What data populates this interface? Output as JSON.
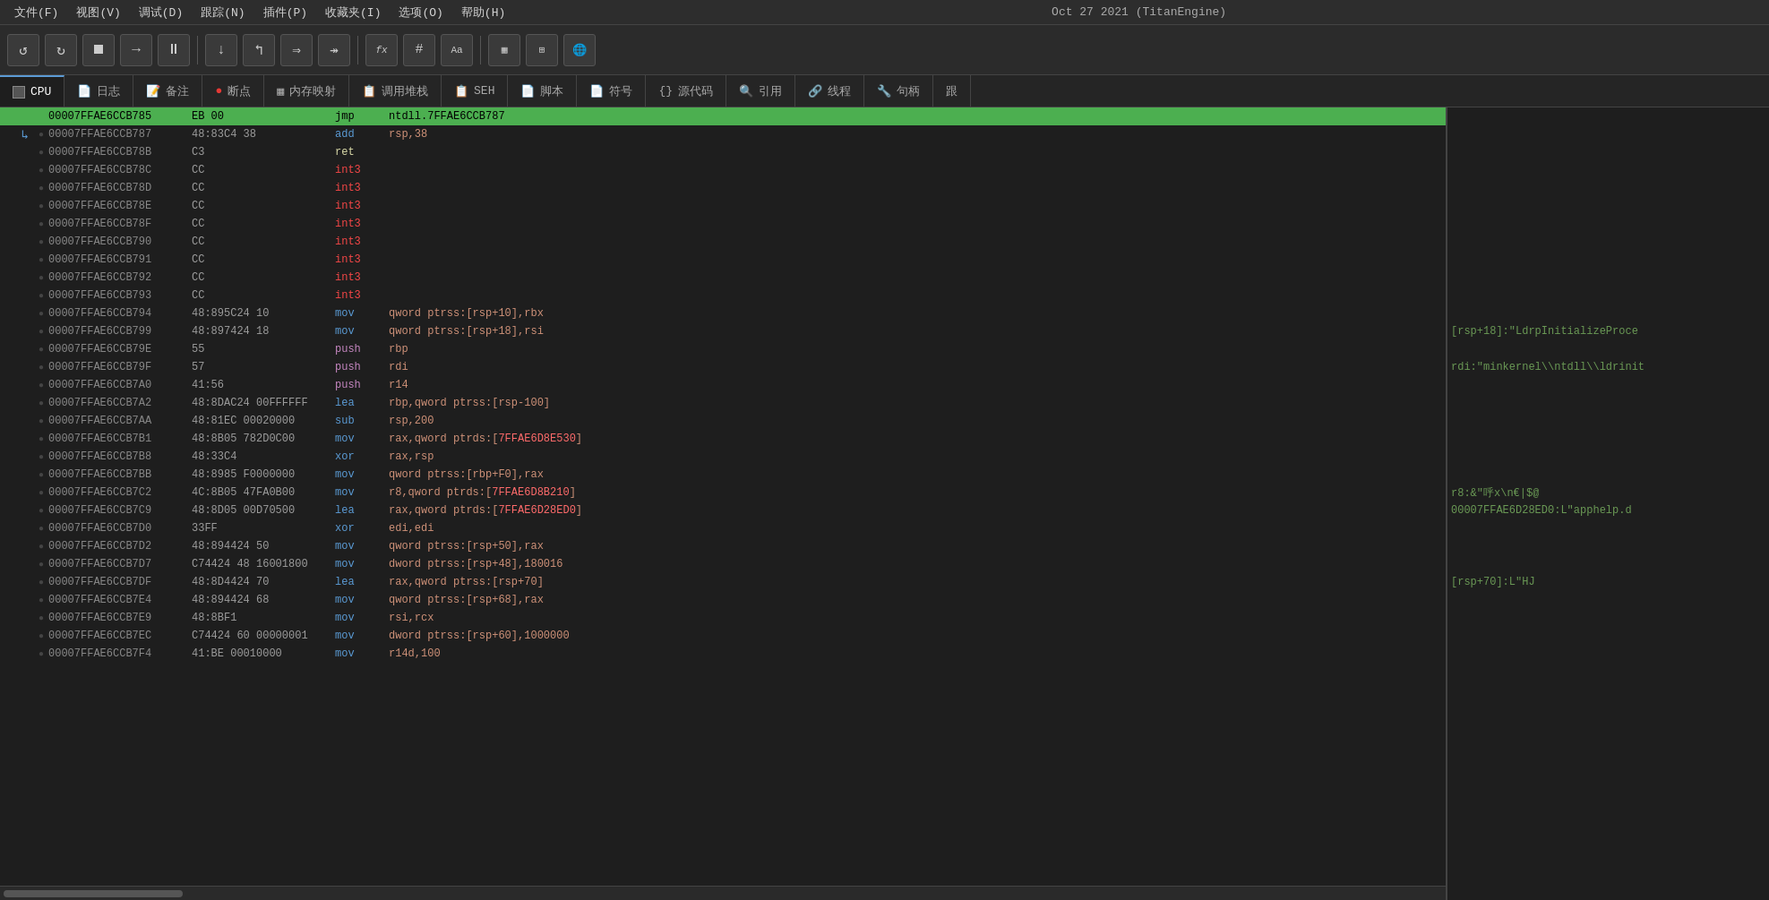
{
  "menubar": {
    "items": [
      "文件(F)",
      "视图(V)",
      "调试(D)",
      "跟踪(N)",
      "插件(P)",
      "收藏夹(I)",
      "选项(O)",
      "帮助(H)"
    ],
    "title": "Oct 27 2021 (TitanEngine)"
  },
  "toolbar": {
    "buttons": [
      {
        "name": "undo-btn",
        "icon": "↺",
        "label": "撤销"
      },
      {
        "name": "redo-btn",
        "icon": "↻",
        "label": "重做"
      },
      {
        "name": "stop-btn",
        "icon": "⏹",
        "label": "停止"
      },
      {
        "name": "right-arrow-btn",
        "icon": "→",
        "label": "步过"
      },
      {
        "name": "pause-btn",
        "icon": "⏸",
        "label": "暂停"
      },
      {
        "name": "step-into-btn",
        "icon": "↓",
        "label": "步入"
      },
      {
        "name": "step-over-btn",
        "icon": "↰",
        "label": "步过"
      },
      {
        "name": "run-btn",
        "icon": "⇒",
        "label": "运行"
      },
      {
        "name": "run-to-btn",
        "icon": "↠",
        "label": "运行到"
      },
      {
        "name": "fx-btn",
        "icon": "fx",
        "label": "表达式"
      },
      {
        "name": "hash-btn",
        "icon": "#",
        "label": "哈希"
      },
      {
        "name": "aa-btn",
        "icon": "Aa",
        "label": "文字"
      },
      {
        "name": "mem-btn",
        "icon": "▦",
        "label": "内存"
      },
      {
        "name": "calc-btn",
        "icon": "⊞",
        "label": "计算器"
      },
      {
        "name": "globe-btn",
        "icon": "🌐",
        "label": "网络"
      }
    ]
  },
  "tabs": [
    {
      "name": "cpu-tab",
      "label": "CPU",
      "icon": "⬜",
      "active": true
    },
    {
      "name": "log-tab",
      "label": "日志",
      "icon": "📄"
    },
    {
      "name": "notes-tab",
      "label": "备注",
      "icon": "📝"
    },
    {
      "name": "breakpoint-tab",
      "label": "断点",
      "icon": "🔴"
    },
    {
      "name": "memory-tab",
      "label": "内存映射",
      "icon": "▦"
    },
    {
      "name": "stack-tab",
      "label": "调用堆栈",
      "icon": "📋"
    },
    {
      "name": "seh-tab",
      "label": "SEH",
      "icon": "📋"
    },
    {
      "name": "script-tab",
      "label": "脚本",
      "icon": "📄"
    },
    {
      "name": "symbol-tab",
      "label": "符号",
      "icon": "📄"
    },
    {
      "name": "source-tab",
      "label": "源代码",
      "icon": "{}"
    },
    {
      "name": "ref-tab",
      "label": "引用",
      "icon": "🔍"
    },
    {
      "name": "thread-tab",
      "label": "线程",
      "icon": "🔗"
    },
    {
      "name": "handle-tab",
      "label": "句柄",
      "icon": "🔧"
    },
    {
      "name": "more-tab",
      "label": "跟",
      "icon": ""
    }
  ],
  "disasm": {
    "rows": [
      {
        "addr": "00007FFAE6CCB785",
        "bytes": "EB 00",
        "mnemonic": "jmp",
        "operands": "ntdll.7FFAE6CCB787",
        "comment": "",
        "highlight": true,
        "bp": false,
        "arrow": false
      },
      {
        "addr": "00007FFAE6CCB787",
        "bytes": "48:83C4 38",
        "mnemonic": "add",
        "operands": "rsp,38",
        "comment": "",
        "highlight": false,
        "bp": false,
        "arrow": true
      },
      {
        "addr": "00007FFAE6CCB78B",
        "bytes": "C3",
        "mnemonic": "ret",
        "operands": "",
        "comment": "",
        "highlight": false,
        "bp": false,
        "arrow": false
      },
      {
        "addr": "00007FFAE6CCB78C",
        "bytes": "CC",
        "mnemonic": "int3",
        "operands": "",
        "comment": "",
        "highlight": false,
        "bp": false,
        "arrow": false
      },
      {
        "addr": "00007FFAE6CCB78D",
        "bytes": "CC",
        "mnemonic": "int3",
        "operands": "",
        "comment": "",
        "highlight": false,
        "bp": false,
        "arrow": false
      },
      {
        "addr": "00007FFAE6CCB78E",
        "bytes": "CC",
        "mnemonic": "int3",
        "operands": "",
        "comment": "",
        "highlight": false,
        "bp": false,
        "arrow": false
      },
      {
        "addr": "00007FFAE6CCB78F",
        "bytes": "CC",
        "mnemonic": "int3",
        "operands": "",
        "comment": "",
        "highlight": false,
        "bp": false,
        "arrow": false
      },
      {
        "addr": "00007FFAE6CCB790",
        "bytes": "CC",
        "mnemonic": "int3",
        "operands": "",
        "comment": "",
        "highlight": false,
        "bp": false,
        "arrow": false
      },
      {
        "addr": "00007FFAE6CCB791",
        "bytes": "CC",
        "mnemonic": "int3",
        "operands": "",
        "comment": "",
        "highlight": false,
        "bp": false,
        "arrow": false
      },
      {
        "addr": "00007FFAE6CCB792",
        "bytes": "CC",
        "mnemonic": "int3",
        "operands": "",
        "comment": "",
        "highlight": false,
        "bp": false,
        "arrow": false
      },
      {
        "addr": "00007FFAE6CCB793",
        "bytes": "CC",
        "mnemonic": "int3",
        "operands": "",
        "comment": "",
        "highlight": false,
        "bp": false,
        "arrow": false
      },
      {
        "addr": "00007FFAE6CCB794",
        "bytes": "48:895C24 10",
        "mnemonic": "mov",
        "operands": "qword ptrss:[rsp+10],rbx",
        "comment": "",
        "highlight": false,
        "bp": false,
        "arrow": false
      },
      {
        "addr": "00007FFAE6CCB799",
        "bytes": "48:897424 18",
        "mnemonic": "mov",
        "operands": "qword ptrss:[rsp+18],rsi",
        "comment": "[rsp+18]:\"LdrpInitializeProce",
        "highlight": false,
        "bp": false,
        "arrow": false
      },
      {
        "addr": "00007FFAE6CCB79E",
        "bytes": "55",
        "mnemonic": "push",
        "operands": "rbp",
        "comment": "",
        "highlight": false,
        "bp": false,
        "arrow": false
      },
      {
        "addr": "00007FFAE6CCB79F",
        "bytes": "57",
        "mnemonic": "push",
        "operands": "rdi",
        "comment": "rdi:\"minkernel\\\\ntdll\\\\ldrinit",
        "highlight": false,
        "bp": false,
        "arrow": false
      },
      {
        "addr": "00007FFAE6CCB7A0",
        "bytes": "41:56",
        "mnemonic": "push",
        "operands": "r14",
        "comment": "",
        "highlight": false,
        "bp": false,
        "arrow": false
      },
      {
        "addr": "00007FFAE6CCB7A2",
        "bytes": "48:8DAC24 00FFFFFF",
        "mnemonic": "lea",
        "operands": "rbp,qword ptrss:[rsp-100]",
        "comment": "",
        "highlight": false,
        "bp": false,
        "arrow": false
      },
      {
        "addr": "00007FFAE6CCB7AA",
        "bytes": "48:81EC 00020000",
        "mnemonic": "sub",
        "operands": "rsp,200",
        "comment": "",
        "highlight": false,
        "bp": false,
        "arrow": false
      },
      {
        "addr": "00007FFAE6CCB7B1",
        "bytes": "48:8B05 782D0C00",
        "mnemonic": "mov",
        "operands": "rax,qword ptrds:[7FFAE6D8E530]",
        "comment": "",
        "highlight": false,
        "bp": false,
        "arrow": false
      },
      {
        "addr": "00007FFAE6CCB7B8",
        "bytes": "48:33C4",
        "mnemonic": "xor",
        "operands": "rax,rsp",
        "comment": "",
        "highlight": false,
        "bp": false,
        "arrow": false
      },
      {
        "addr": "00007FFAE6CCB7BB",
        "bytes": "48:8985 F0000000",
        "mnemonic": "mov",
        "operands": "qword ptrss:[rbp+F0],rax",
        "comment": "",
        "highlight": false,
        "bp": false,
        "arrow": false
      },
      {
        "addr": "00007FFAE6CCB7C2",
        "bytes": "4C:8B05 47FA0B00",
        "mnemonic": "mov",
        "operands": "r8,qword ptrds:[7FFAE6D8B210]",
        "comment": "r8:&\"呼x\\n€|$@",
        "highlight": false,
        "bp": false,
        "arrow": false
      },
      {
        "addr": "00007FFAE6CCB7C9",
        "bytes": "48:8D05 00D70500",
        "mnemonic": "lea",
        "operands": "rax,qword ptrds:[7FFAE6D28ED0]",
        "comment": "00007FFAE6D28ED0:L\"apphelp.d",
        "highlight": false,
        "bp": false,
        "arrow": false
      },
      {
        "addr": "00007FFAE6CCB7D0",
        "bytes": "33FF",
        "mnemonic": "xor",
        "operands": "edi,edi",
        "comment": "",
        "highlight": false,
        "bp": false,
        "arrow": false
      },
      {
        "addr": "00007FFAE6CCB7D2",
        "bytes": "48:894424 50",
        "mnemonic": "mov",
        "operands": "qword ptrss:[rsp+50],rax",
        "comment": "",
        "highlight": false,
        "bp": false,
        "arrow": false
      },
      {
        "addr": "00007FFAE6CCB7D7",
        "bytes": "C74424 48 16001800",
        "mnemonic": "mov",
        "operands": "dword ptrss:[rsp+48],180016",
        "comment": "",
        "highlight": false,
        "bp": false,
        "arrow": false
      },
      {
        "addr": "00007FFAE6CCB7DF",
        "bytes": "48:8D4424 70",
        "mnemonic": "lea",
        "operands": "rax,qword ptrss:[rsp+70]",
        "comment": "[rsp+70]:L\"HJ",
        "highlight": false,
        "bp": false,
        "arrow": false
      },
      {
        "addr": "00007FFAE6CCB7E4",
        "bytes": "48:894424 68",
        "mnemonic": "mov",
        "operands": "qword ptrss:[rsp+68],rax",
        "comment": "",
        "highlight": false,
        "bp": false,
        "arrow": false
      },
      {
        "addr": "00007FFAE6CCB7E9",
        "bytes": "48:8BF1",
        "mnemonic": "mov",
        "operands": "rsi,rcx",
        "comment": "",
        "highlight": false,
        "bp": false,
        "arrow": false
      },
      {
        "addr": "00007FFAE6CCB7EC",
        "bytes": "C74424 60 00000001",
        "mnemonic": "mov",
        "operands": "dword ptrss:[rsp+60],1000000",
        "comment": "",
        "highlight": false,
        "bp": false,
        "arrow": false
      },
      {
        "addr": "00007FFAE6CCB7F4",
        "bytes": "41:BE 00010000",
        "mnemonic": "mov",
        "operands": "r14d,100",
        "comment": "",
        "highlight": false,
        "bp": false,
        "arrow": false
      }
    ]
  },
  "right_comments": {
    "rows": [
      {
        "row": 0,
        "text": ""
      },
      {
        "row": 1,
        "text": ""
      },
      {
        "row": 2,
        "text": ""
      },
      {
        "row": 3,
        "text": ""
      },
      {
        "row": 4,
        "text": ""
      },
      {
        "row": 5,
        "text": ""
      },
      {
        "row": 6,
        "text": ""
      },
      {
        "row": 7,
        "text": ""
      },
      {
        "row": 8,
        "text": ""
      },
      {
        "row": 9,
        "text": ""
      },
      {
        "row": 10,
        "text": ""
      },
      {
        "row": 11,
        "text": ""
      },
      {
        "row": 12,
        "text": "[rsp+18]:\"LdrpInitializeProce"
      },
      {
        "row": 13,
        "text": ""
      },
      {
        "row": 14,
        "text": "rdi:\"minkernel\\\\ntdll\\\\ldrinit"
      },
      {
        "row": 15,
        "text": ""
      },
      {
        "row": 16,
        "text": ""
      },
      {
        "row": 17,
        "text": ""
      },
      {
        "row": 18,
        "text": ""
      },
      {
        "row": 19,
        "text": ""
      },
      {
        "row": 20,
        "text": ""
      },
      {
        "row": 21,
        "text": "r8:&\"呼x\\n€|$@"
      },
      {
        "row": 22,
        "text": "00007FFAE6D28ED0:L\"apphelp.d"
      },
      {
        "row": 23,
        "text": ""
      },
      {
        "row": 24,
        "text": ""
      },
      {
        "row": 25,
        "text": ""
      },
      {
        "row": 26,
        "text": "[rsp+70]:L\"HJ"
      },
      {
        "row": 27,
        "text": ""
      },
      {
        "row": 28,
        "text": ""
      },
      {
        "row": 29,
        "text": ""
      },
      {
        "row": 30,
        "text": ""
      }
    ]
  }
}
